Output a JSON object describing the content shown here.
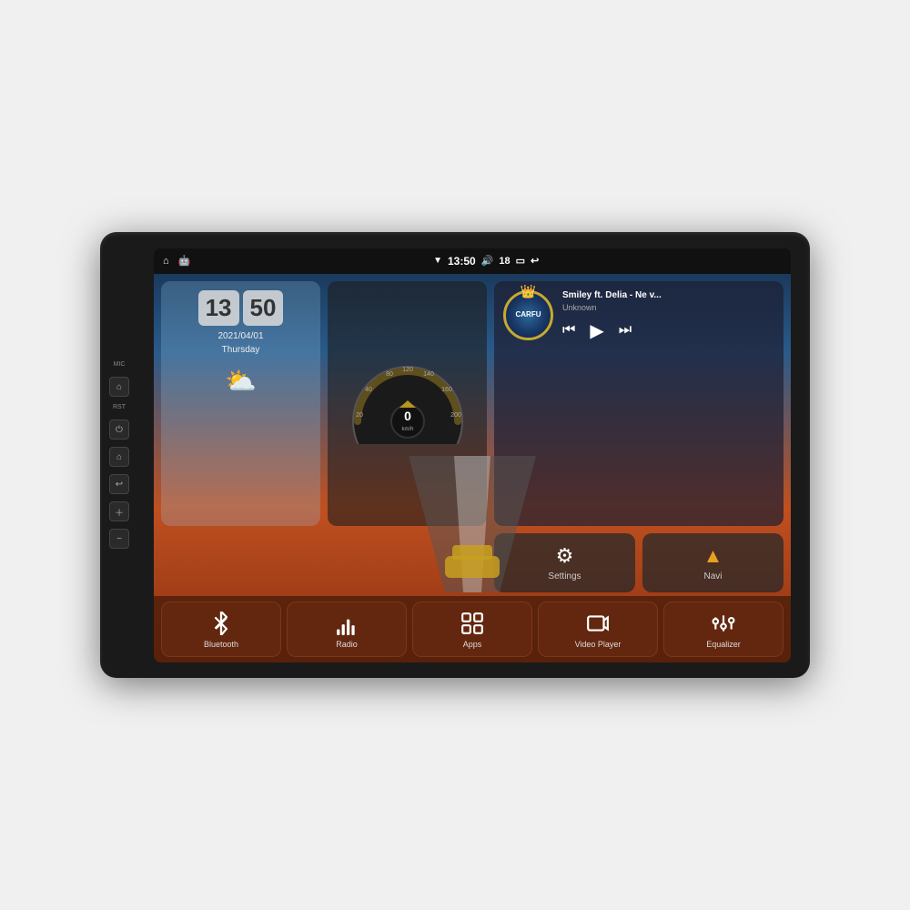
{
  "device": {
    "side_labels": [
      "MIC",
      "RST"
    ],
    "side_buttons": [
      "home",
      "power",
      "back",
      "vol_up",
      "vol_down"
    ]
  },
  "status_bar": {
    "left_icons": [
      "home",
      "android"
    ],
    "time": "13:50",
    "wifi_signal": "▼",
    "volume_icon": "🔊",
    "volume_level": "18",
    "battery_icon": "🔋",
    "back_icon": "↩"
  },
  "clock": {
    "time": "13:50",
    "hour": "13",
    "minute": "50",
    "date": "2021/04/01",
    "day": "Thursday"
  },
  "speedometer": {
    "speed": "0",
    "unit": "km/h"
  },
  "music": {
    "title": "Smiley ft. Delia - Ne v...",
    "artist": "Unknown",
    "logo": "CARFU"
  },
  "quick_buttons": [
    {
      "id": "settings",
      "label": "Settings",
      "icon": "⚙"
    },
    {
      "id": "navi",
      "label": "Navi",
      "icon": "▲"
    }
  ],
  "apps": [
    {
      "id": "bluetooth",
      "label": "Bluetooth",
      "icon": "bluetooth"
    },
    {
      "id": "radio",
      "label": "Radio",
      "icon": "radio"
    },
    {
      "id": "apps",
      "label": "Apps",
      "icon": "apps"
    },
    {
      "id": "video-player",
      "label": "Video Player",
      "icon": "video"
    },
    {
      "id": "equalizer",
      "label": "Equalizer",
      "icon": "equalizer"
    }
  ]
}
